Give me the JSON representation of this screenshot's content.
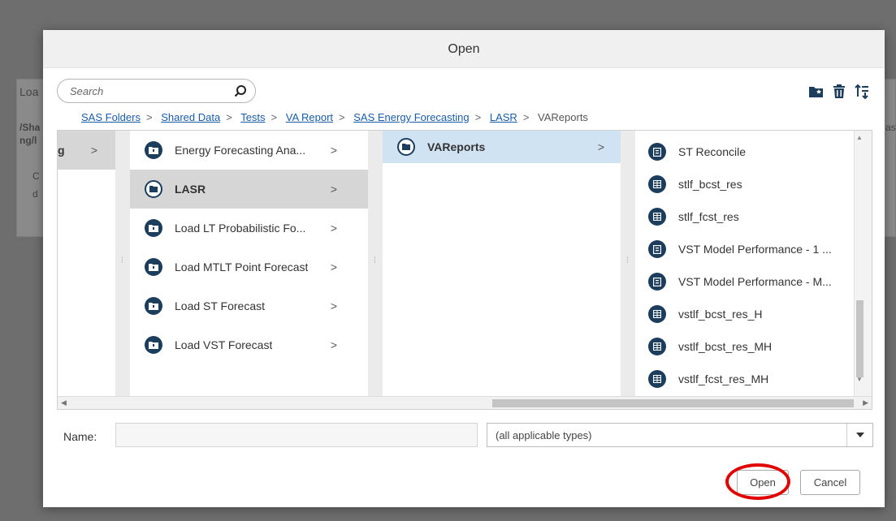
{
  "background": {
    "panel_title": "Loa",
    "path_line1": "/Sha",
    "path_line2": "ng/l",
    "right_fragment": "ast",
    "fragment_c": "C",
    "fragment_d": "d"
  },
  "dialog": {
    "title": "Open",
    "search": {
      "placeholder": "Search"
    },
    "toolbar": {
      "new_folder_icon": "new-folder-icon",
      "delete_icon": "trash-icon",
      "sort_icon": "sort-icon"
    },
    "breadcrumb": {
      "items": [
        "SAS Folders",
        "Shared Data",
        "Tests",
        "VA Report",
        "SAS Energy Forecasting",
        "LASR"
      ],
      "current": "VAReports",
      "separator": ">"
    },
    "columns": {
      "col1": {
        "partial_label": "g",
        "chevron": ">"
      },
      "col2": [
        {
          "label": "Energy Forecasting Ana...",
          "chevron": ">"
        },
        {
          "label": "LASR",
          "chevron": ">"
        },
        {
          "label": "Load LT Probabilistic Fo...",
          "chevron": ">"
        },
        {
          "label": "Load MTLT Point Forecast",
          "chevron": ">"
        },
        {
          "label": "Load ST Forecast",
          "chevron": ">"
        },
        {
          "label": "Load VST Forecast",
          "chevron": ">"
        }
      ],
      "col3": [
        {
          "label": "VAReports",
          "chevron": ">"
        }
      ],
      "col4": [
        {
          "label": "ST Reconcile",
          "kind": "report"
        },
        {
          "label": "stlf_bcst_res",
          "kind": "table"
        },
        {
          "label": "stlf_fcst_res",
          "kind": "table"
        },
        {
          "label": "VST Model Performance - 1 ...",
          "kind": "report"
        },
        {
          "label": "VST Model Performance - M...",
          "kind": "report"
        },
        {
          "label": "vstlf_bcst_res_H",
          "kind": "table"
        },
        {
          "label": "vstlf_bcst_res_MH",
          "kind": "table"
        },
        {
          "label": "vstlf_fcst_res_MH",
          "kind": "table"
        }
      ]
    },
    "name": {
      "label": "Name:",
      "value": ""
    },
    "file_type": {
      "selected": "(all applicable types)"
    },
    "buttons": {
      "open": "Open",
      "cancel": "Cancel"
    },
    "colors": {
      "accent": "#1c3d5c",
      "link": "#1a5ca8",
      "selected_blue": "#cfe3f2",
      "highlight_ring": "#e00000"
    }
  }
}
